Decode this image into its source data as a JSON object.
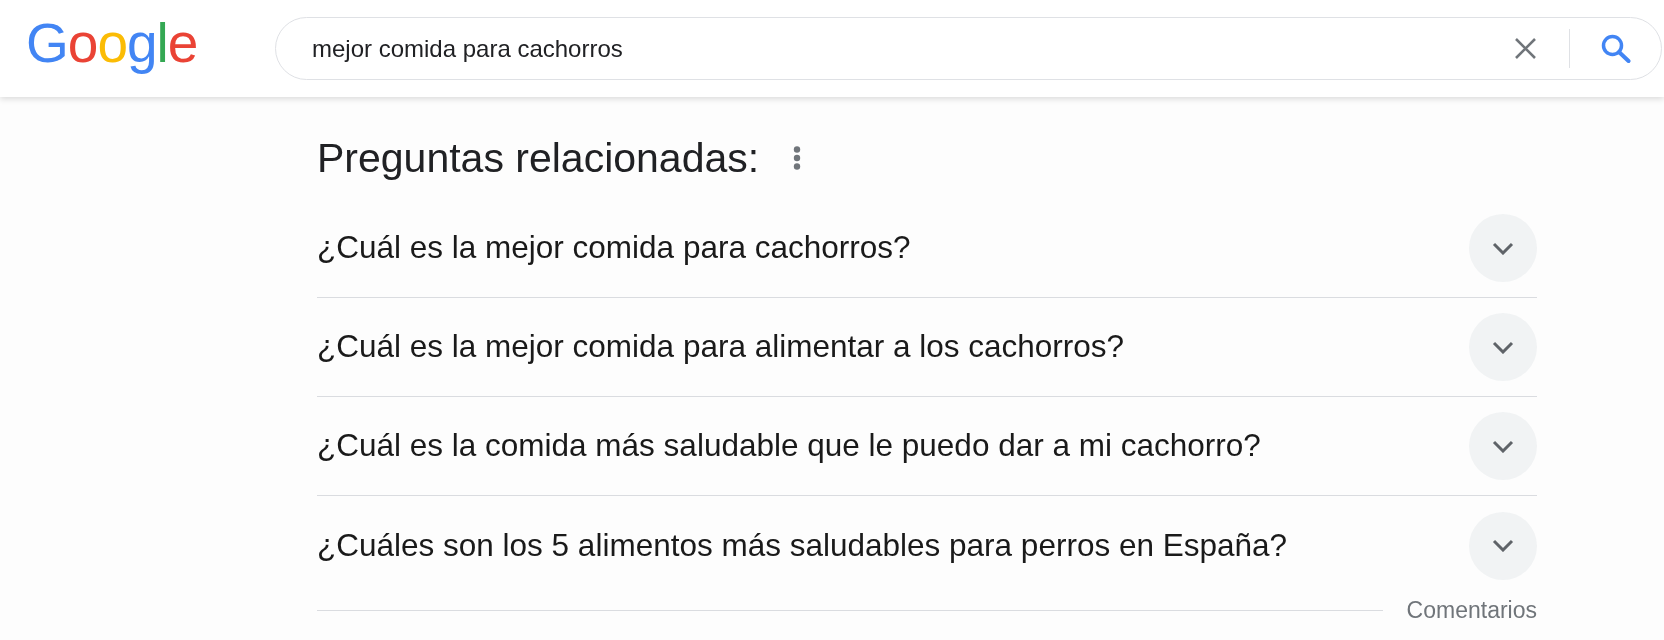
{
  "header": {
    "logo": "Google",
    "search": {
      "value": "mejor comida para cachorros"
    }
  },
  "related_questions": {
    "title": "Preguntas relacionadas:",
    "questions": [
      {
        "text": "¿Cuál es la mejor comida para cachorros?",
        "expanded": false
      },
      {
        "text": "¿Cuál es la mejor comida para alimentar a los cachorros?",
        "expanded": false
      },
      {
        "text": "¿Cuál es la comida más saludable que le puedo dar a mi cachorro?",
        "expanded": false
      },
      {
        "text": "¿Cuáles son los 5 alimentos más saludables para perros en España?",
        "expanded": false
      }
    ],
    "feedback_link": "Comentarios"
  }
}
